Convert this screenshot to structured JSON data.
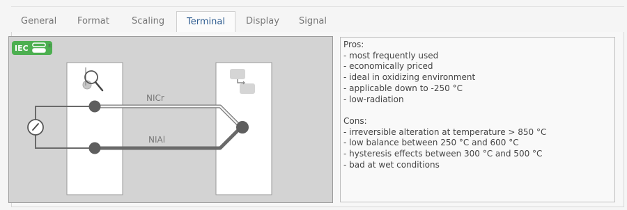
{
  "tabs": [
    {
      "label": "General"
    },
    {
      "label": "Format"
    },
    {
      "label": "Scaling"
    },
    {
      "label": "Terminal"
    },
    {
      "label": "Display"
    },
    {
      "label": "Signal"
    }
  ],
  "active_tab": "Terminal",
  "diagram": {
    "badge": "IEC",
    "badge_color": "#4caf50",
    "wire_top_label": "NICr",
    "wire_bottom_label": "NIAl",
    "icons": [
      "magnifier-icon",
      "gauge-icon",
      "device-icon"
    ]
  },
  "description": {
    "pros_title": "Pros:",
    "pros": [
      "- most frequently used",
      "- economically priced",
      "- ideal in oxidizing environment",
      "- applicable down to -250 °C",
      "- low-radiation"
    ],
    "cons_title": "Cons:",
    "cons": [
      "- irreversible alteration at temperature > 850 °C",
      "- low balance between 250 °C and 600 °C",
      "- hysteresis effects between 300 °C and 500 °C",
      "- bad at wet conditions"
    ]
  }
}
